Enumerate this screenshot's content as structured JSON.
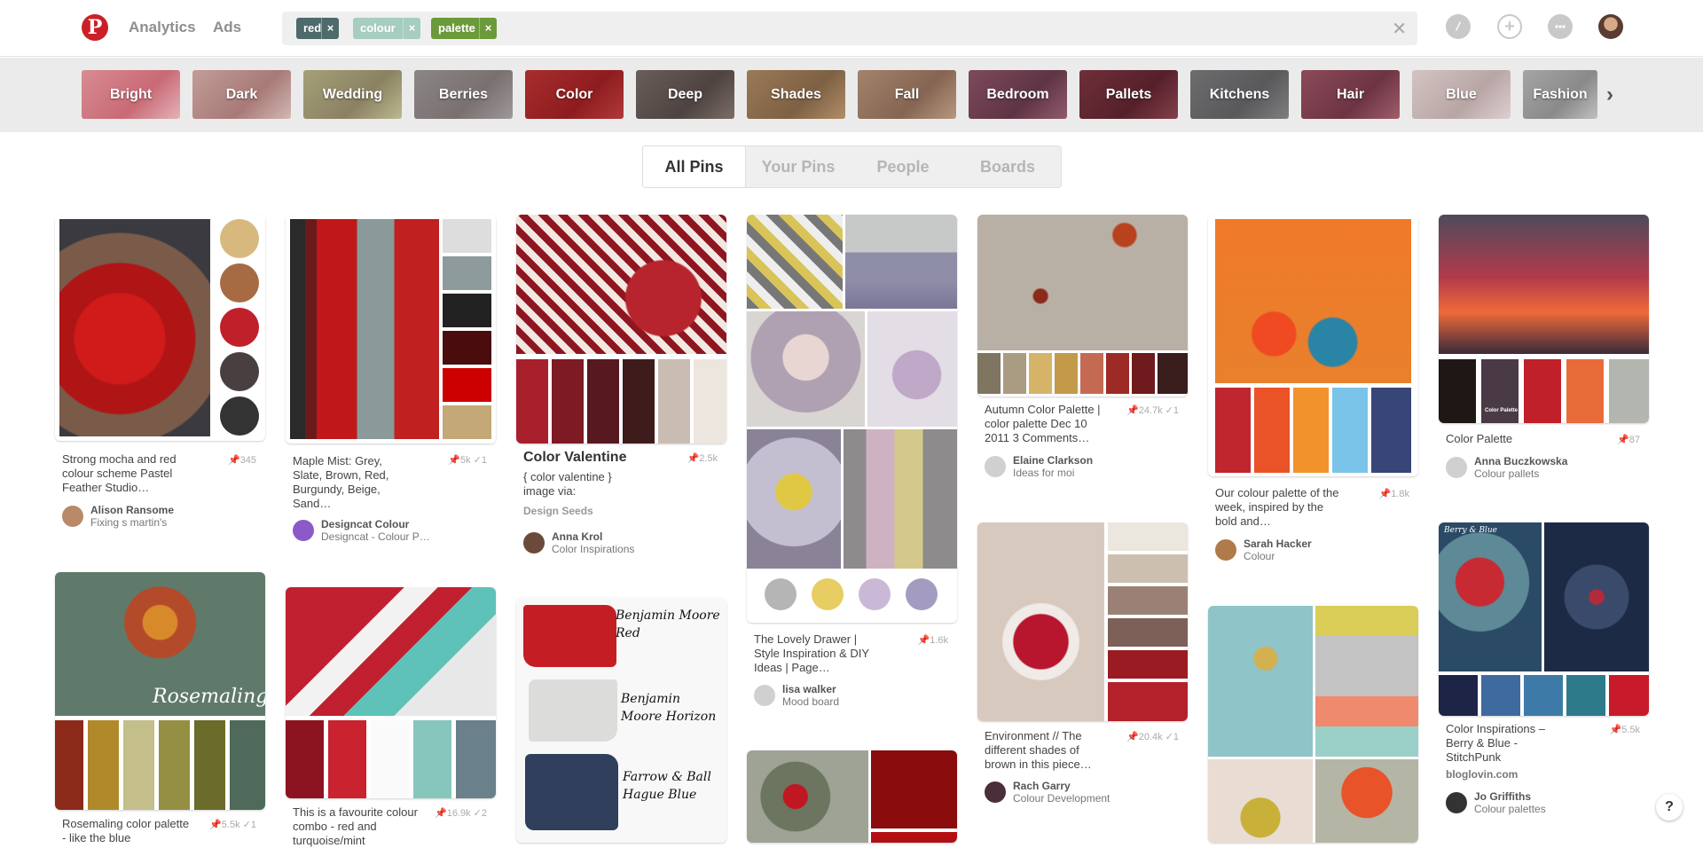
{
  "header": {
    "logo": "P",
    "nav": [
      "Analytics",
      "Ads"
    ],
    "search_tokens": [
      {
        "label": "red",
        "color": "#4e6a6a"
      },
      {
        "label": "colour",
        "color": "#a6cdbf"
      },
      {
        "label": "palette",
        "color": "#6b9a3a"
      }
    ],
    "clear_symbol": "✕",
    "icons": [
      "compass-icon",
      "plus-icon",
      "chat-icon",
      "avatar"
    ]
  },
  "guided_search": {
    "chips": [
      "Bright",
      "Dark",
      "Wedding",
      "Berries",
      "Color",
      "Deep",
      "Shades",
      "Fall",
      "Bedroom",
      "Pallets",
      "Kitchens",
      "Hair",
      "Blue",
      "Fashion"
    ],
    "next_symbol": "›"
  },
  "tabs": [
    "All Pins",
    "Your Pins",
    "People",
    "Boards"
  ],
  "pins": [
    {
      "desc": "Strong mocha and red colour scheme Pastel Feather Studio…",
      "stats": "📌345",
      "pinner": "Alison Ransome",
      "board": "Fixing s martin's"
    },
    {
      "desc": "Maple Mist: Grey, Slate, Brown, Red, Burgundy, Beige, Sand…",
      "stats": "📌5k ✓1",
      "pinner": "Designcat Colour",
      "board": "Designcat - Colour P…"
    },
    {
      "desc": "Color Valentine",
      "stats": "📌2.5k",
      "extra": "{ color valentine } image via:",
      "source": "Design Seeds",
      "pinner": "Anna Krol",
      "board": "Color Inspirations"
    },
    {
      "desc": "The Lovely Drawer | Style Inspiration & DIY Ideas | Page…",
      "stats": "📌1.6k",
      "pinner": "lisa walker",
      "board": "Mood board"
    },
    {
      "desc": "Autumn Color Palette | color palette Dec 10 2011 3 Comments…",
      "stats": "📌24.7k ✓1",
      "pinner": "Elaine Clarkson",
      "board": "Ideas for moi"
    },
    {
      "desc": "Our colour palette of the week, inspired by the bold and…",
      "stats": "📌1.8k",
      "pinner": "Sarah Hacker",
      "board": "Colour"
    },
    {
      "desc": "Color Palette",
      "stats": "📌87",
      "pinner": "Anna Buczkowska",
      "board": "Colour pallets"
    },
    {
      "desc": "Environment // The different shades of brown in this piece…",
      "stats": "📌20.4k ✓1",
      "pinner": "Rach Garry",
      "board": "Colour Development"
    },
    {
      "desc": "Color Inspirations – Berry & Blue - StitchPunk",
      "stats": "📌5.5k",
      "source": "bloglovin.com",
      "pinner": "Jo Griffiths",
      "board": "Colour palettes"
    },
    {
      "desc": "Rosemaling color palette - like the blue",
      "stats": "📌5.5k ✓1"
    },
    {
      "desc": "This is a favourite colour combo - red and turquoise/mint",
      "stats": "📌16.9k ✓2"
    }
  ],
  "image_text": {
    "rosemaling": "Rosemaling",
    "bm_red": "Benjamin Moore Red",
    "bm_horizon": "Benjamin Moore Horizon",
    "fb_blue": "Farrow & Ball Hague Blue",
    "color_palette": "Color Palette",
    "berry_blue": "Berry & Blue"
  },
  "help_label": "?"
}
